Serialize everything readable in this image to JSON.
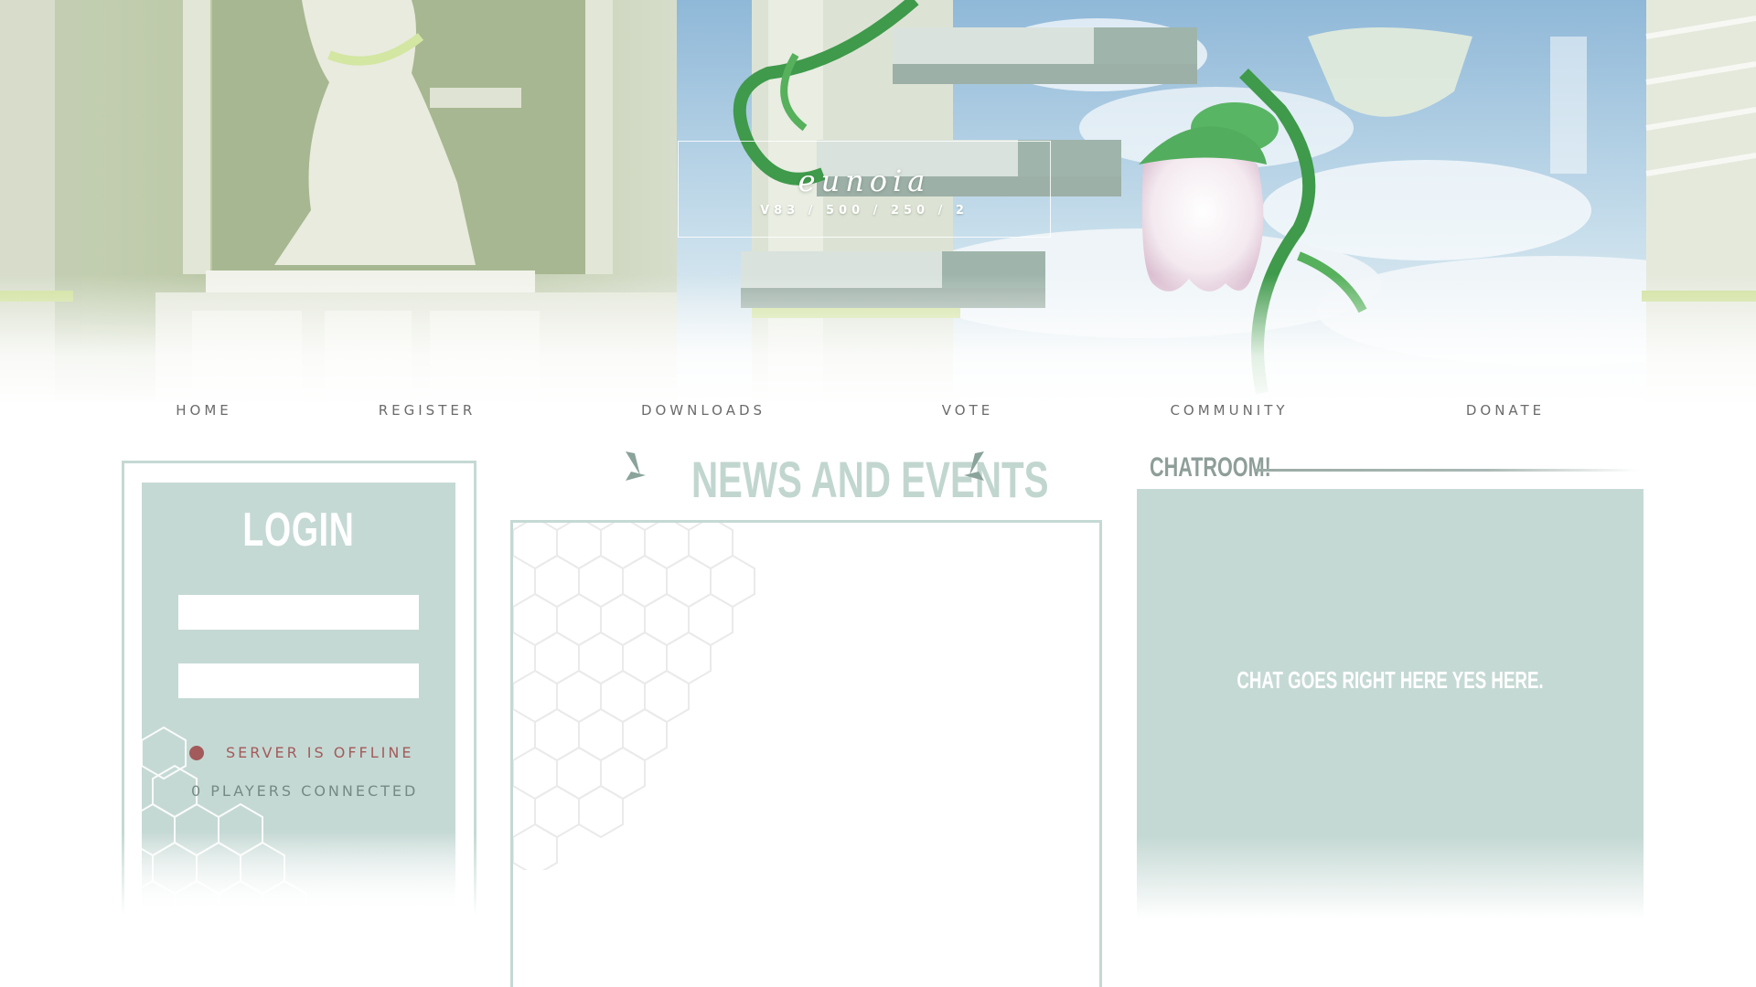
{
  "header": {
    "title": "eunoia",
    "subtitle": "V83 / 500 / 250 / 2"
  },
  "nav": {
    "items": [
      {
        "label": "HOME"
      },
      {
        "label": "REGISTER"
      },
      {
        "label": "DOWNLOADS"
      },
      {
        "label": "VOTE"
      },
      {
        "label": "COMMUNITY"
      },
      {
        "label": "DONATE"
      }
    ]
  },
  "login": {
    "title": "LOGIN",
    "username": {
      "value": "",
      "placeholder": ""
    },
    "password": {
      "value": "",
      "placeholder": ""
    },
    "status_text": "SERVER IS OFFLINE",
    "players_text": "0 PLAYERS CONNECTED",
    "status_color": "#a35a5a"
  },
  "news": {
    "title": "NEWS AND EVENTS"
  },
  "chat": {
    "title": "CHATROOM!",
    "placeholder_text": "CHAT GOES RIGHT HERE YES HERE."
  },
  "colors": {
    "accent": "#c5d9d4",
    "nav_text": "#6b6b6b",
    "heading_light": "#c2d6d0"
  },
  "icons": {
    "status": "status-dot-icon",
    "news_decoration": "sparkle-lines-icon"
  }
}
